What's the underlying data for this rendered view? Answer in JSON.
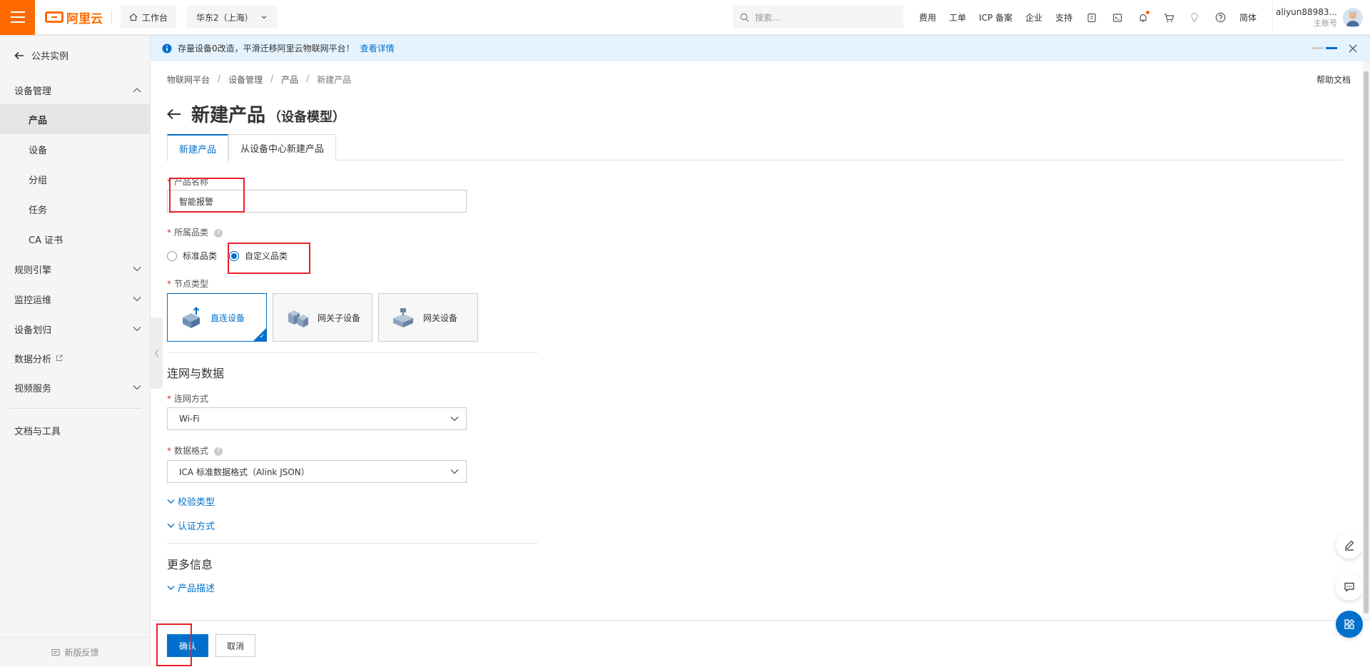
{
  "topbar": {
    "logo_text": "阿里云",
    "workbench": "工作台",
    "region": "华东2（上海）",
    "search_placeholder": "搜索...",
    "nav": [
      "费用",
      "工单",
      "ICP 备案",
      "企业",
      "支持"
    ],
    "lang": "简体",
    "account_name": "aliyun88983...",
    "account_role": "主账号"
  },
  "sidebar": {
    "back": "公共实例",
    "device_mgmt": "设备管理",
    "items": [
      "产品",
      "设备",
      "分组",
      "任务",
      "CA 证书"
    ],
    "groups": [
      "规则引擎",
      "监控运维",
      "设备划归",
      "数据分析",
      "视频服务"
    ],
    "docs": "文档与工具",
    "feedback": "新版反馈"
  },
  "notice": {
    "text": "存量设备0改造，平滑迁移阿里云物联网平台！",
    "link": "查看详情"
  },
  "breadcrumb": [
    "物联网平台",
    "设备管理",
    "产品",
    "新建产品"
  ],
  "help_doc": "帮助文档",
  "page": {
    "title": "新建产品",
    "subtitle": "（设备模型）"
  },
  "tabs": [
    "新建产品",
    "从设备中心新建产品"
  ],
  "form": {
    "product_name_label": "产品名称",
    "product_name_value": "智能报警",
    "category_label": "所属品类",
    "category_options": [
      "标准品类",
      "自定义品类"
    ],
    "node_type_label": "节点类型",
    "node_types": [
      "直连设备",
      "网关子设备",
      "网关设备"
    ],
    "section_network": "连网与数据",
    "network_label": "连网方式",
    "network_value": "Wi-Fi",
    "data_format_label": "数据格式",
    "data_format_value": "ICA 标准数据格式（Alink JSON）",
    "check_type": "校验类型",
    "auth_method": "认证方式",
    "section_more": "更多信息",
    "product_desc": "产品描述"
  },
  "footer": {
    "confirm": "确认",
    "cancel": "取消"
  },
  "colors": {
    "brand": "#ff6a00",
    "primary": "#0070cc",
    "annotation": "#e8202a"
  }
}
